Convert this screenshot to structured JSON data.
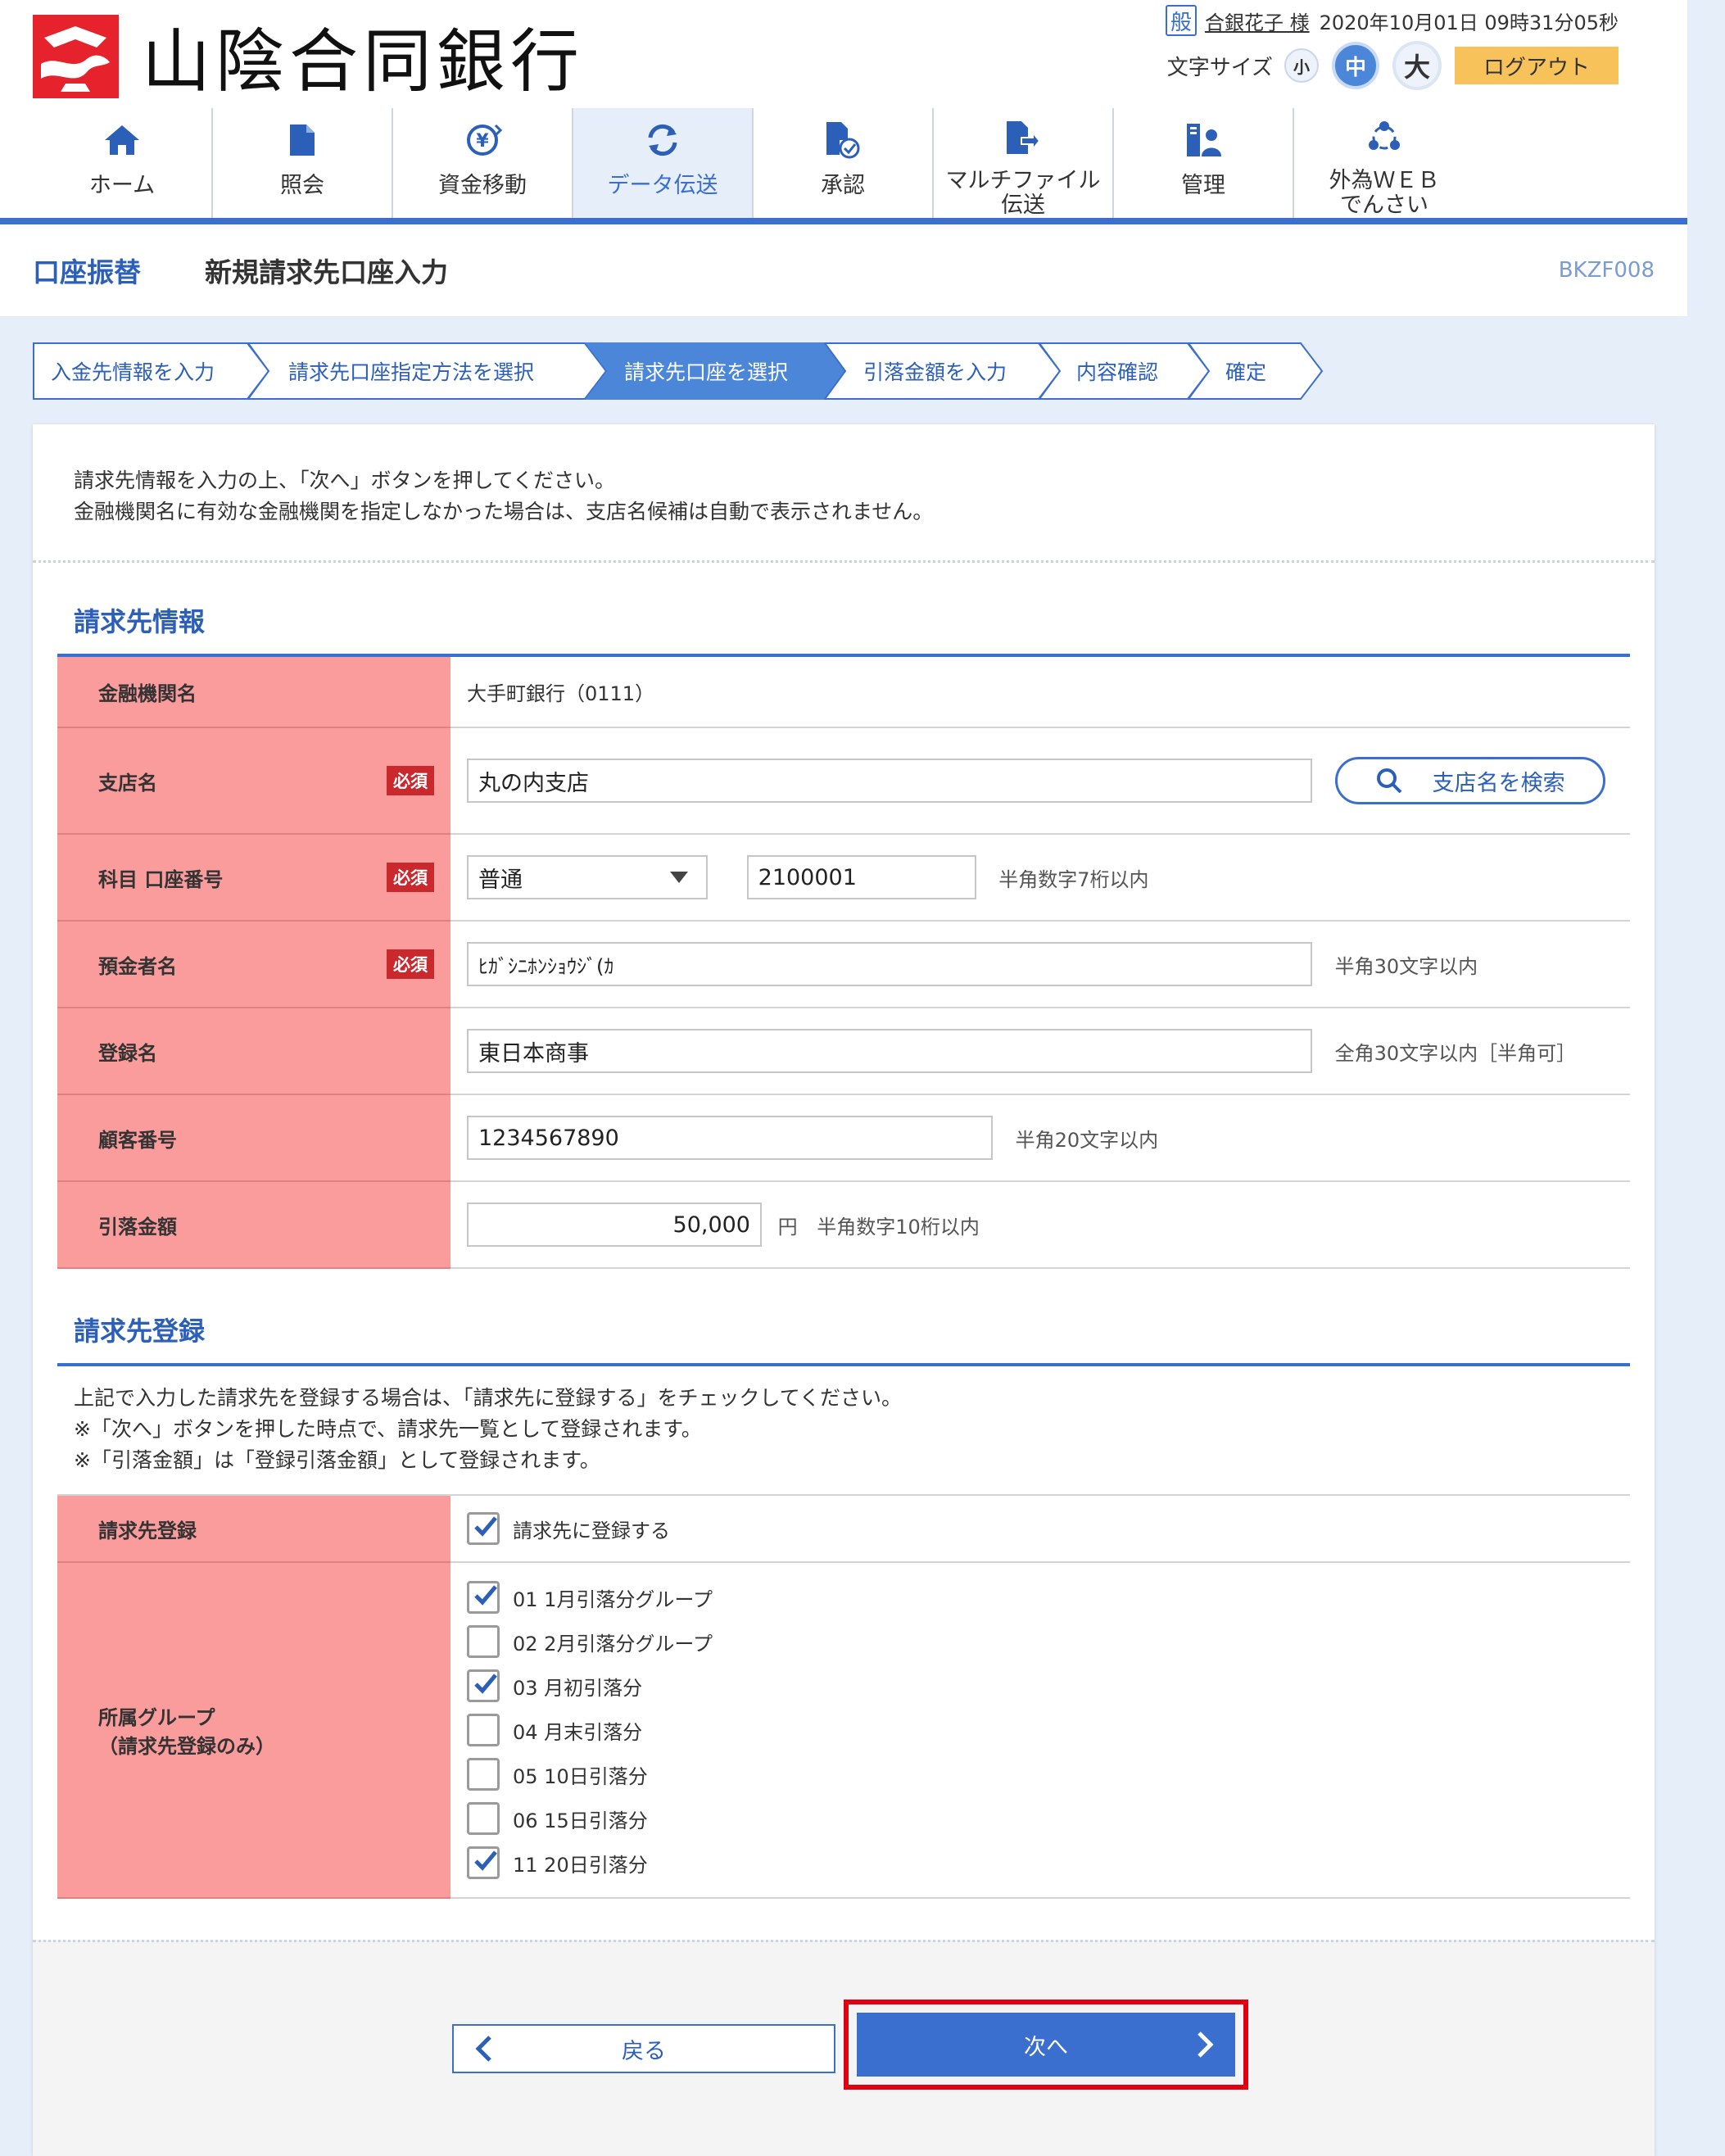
{
  "brand": {
    "name": "山陰合同銀行",
    "logo_color": "#e6222d"
  },
  "user": {
    "badge": "般",
    "name": "合銀花子 様",
    "datetime": "2020年10月01日 09時31分05秒"
  },
  "fontsize": {
    "label": "文字サイズ",
    "small": "小",
    "medium": "中",
    "large": "大",
    "selected": "中"
  },
  "logout_label": "ログアウト",
  "nav": [
    {
      "label": "ホーム",
      "icon": "home-icon"
    },
    {
      "label": "照会",
      "icon": "document-icon"
    },
    {
      "label": "資金移動",
      "icon": "yen-transfer-icon"
    },
    {
      "label": "データ伝送",
      "icon": "sync-icon",
      "active": true
    },
    {
      "label": "承認",
      "icon": "approve-icon"
    },
    {
      "label": "マルチファイル",
      "label2": "伝送",
      "icon": "file-send-icon"
    },
    {
      "label": "管理",
      "icon": "admin-icon"
    },
    {
      "label": "外為ＷＥＢ",
      "label2": "でんさい",
      "icon": "network-icon"
    }
  ],
  "page": {
    "category": "口座振替",
    "title": "新規請求先口座入力",
    "screen_id": "BKZF008"
  },
  "steps": [
    {
      "label": "入金先情報を入力",
      "state": "done"
    },
    {
      "label": "請求先口座指定方法を選択",
      "state": "done"
    },
    {
      "label": "請求先口座を選択",
      "state": "current"
    },
    {
      "label": "引落金額を入力",
      "state": "todo"
    },
    {
      "label": "内容確認",
      "state": "todo"
    },
    {
      "label": "確定",
      "state": "todo"
    }
  ],
  "intro": [
    "請求先情報を入力の上、「次へ」ボタンを押してください。",
    "金融機関名に有効な金融機関を指定しなかった場合は、支店名候補は自動で表示されません。"
  ],
  "section1": {
    "title": "請求先情報",
    "required_label": "必須",
    "rows": {
      "bank": {
        "label": "金融機関名",
        "value": "大手町銀行（0111）"
      },
      "branch": {
        "label": "支店名",
        "value": "丸の内支店",
        "search_button": "支店名を検索"
      },
      "account": {
        "label": "科目 口座番号",
        "type": "普通",
        "number": "2100001",
        "hint": "半角数字7桁以内"
      },
      "holder": {
        "label": "預金者名",
        "value": "ﾋｶﾞｼﾆﾎﾝｼｮｳｼﾞ(ｶ",
        "hint": "半角30文字以内"
      },
      "regname": {
        "label": "登録名",
        "value": "東日本商事",
        "hint": "全角30文字以内［半角可］"
      },
      "customer": {
        "label": "顧客番号",
        "value": "1234567890",
        "hint": "半角20文字以内"
      },
      "amount": {
        "label": "引落金額",
        "value": "50,000",
        "unit": "円",
        "hint": "半角数字10桁以内"
      }
    }
  },
  "section2": {
    "title": "請求先登録",
    "notes": [
      "上記で入力した請求先を登録する場合は、「請求先に登録する」をチェックしてください。",
      "※「次へ」ボタンを押した時点で、請求先一覧として登録されます。",
      "※「引落金額」は「登録引落金額」として登録されます。"
    ],
    "register": {
      "label": "請求先登録",
      "checkbox_label": "請求先に登録する",
      "checked": true
    },
    "groups": {
      "label1": "所属グループ",
      "label2": "（請求先登録のみ）",
      "items": [
        {
          "label": "01 1月引落分グループ",
          "checked": true
        },
        {
          "label": "02 2月引落分グループ",
          "checked": false
        },
        {
          "label": "03 月初引落分",
          "checked": true
        },
        {
          "label": "04 月末引落分",
          "checked": false
        },
        {
          "label": "05 10日引落分",
          "checked": false
        },
        {
          "label": "06 15日引落分",
          "checked": false
        },
        {
          "label": "11 20日引落分",
          "checked": true
        }
      ]
    }
  },
  "buttons": {
    "back": "戻る",
    "next": "次へ"
  },
  "colors": {
    "accent": "#3b6fcf",
    "header_cell": "#fa9c9c",
    "required": "#c9282d",
    "highlight": "#e00012"
  }
}
